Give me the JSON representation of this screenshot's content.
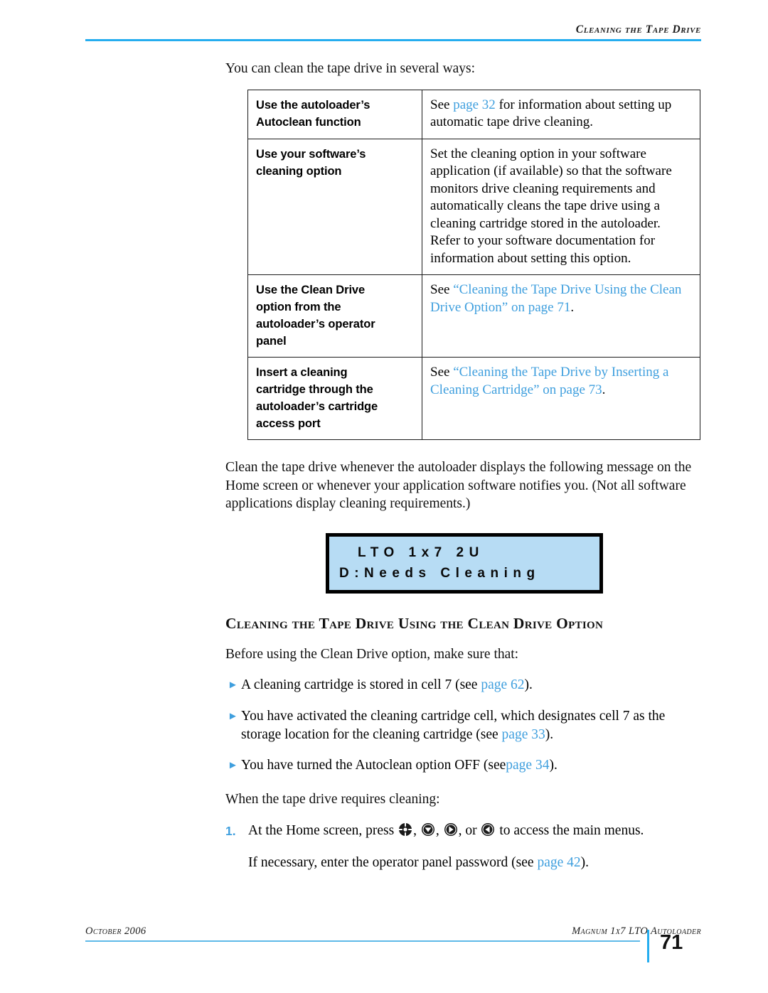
{
  "header": {
    "title": "Cleaning the Tape Drive"
  },
  "intro": {
    "lead": "You can clean the tape drive in several ways:"
  },
  "methods_table": {
    "rows": [
      {
        "label_line1": "Use the autoloader’s",
        "label_line2": "Autoclean function",
        "desc_prefix": "See ",
        "desc_link": "page 32",
        "desc_suffix": " for information about setting up automatic tape drive cleaning."
      },
      {
        "label_line1": "Use your software’s",
        "label_line2": "cleaning option",
        "desc_prefix": "Set the cleaning option in your software application (if available) so that the software monitors drive cleaning requirements and automatically cleans the tape drive using a cleaning cartridge stored in the autoloader. Refer to your software documentation for information about setting this option.",
        "desc_link": "",
        "desc_suffix": ""
      },
      {
        "label_line1": "Use the Clean Drive",
        "label_line2": "option from the",
        "label_line3": "autoloader’s operator",
        "label_line4": "panel",
        "desc_prefix": "See ",
        "desc_link": "“Cleaning the Tape Drive Using the Clean Drive Option” on page 71",
        "desc_suffix": "."
      },
      {
        "label_line1": "Insert a cleaning",
        "label_line2": "cartridge through the",
        "label_line3": "autoloader’s cartridge",
        "label_line4": "access port",
        "desc_prefix": "See ",
        "desc_link": "“Cleaning the Tape Drive by Inserting a Cleaning Cartridge” on page 73",
        "desc_suffix": "."
      }
    ]
  },
  "message_paragraph": "Clean the tape drive whenever the autoloader displays the following message on the Home screen or whenever your application software notifies you. (Not all software applications display cleaning requirements.)",
  "lcd": {
    "line1": "LTO 1x7 2U",
    "line2": "D:Needs Cleaning"
  },
  "section": {
    "heading": "Cleaning the Tape Drive Using the Clean Drive Option",
    "intro": "Before using the Clean Drive option, make sure that:"
  },
  "bullets": [
    {
      "marker": "triangle-right",
      "prefix": "A cleaning cartridge is stored in cell 7 (see ",
      "link": "page 62",
      "suffix": ")."
    },
    {
      "marker": "triangle-right",
      "prefix": "You have activated the cleaning cartridge cell, which designates cell 7 as the storage location for the cleaning cartridge (see ",
      "link": "page 33",
      "suffix": ")."
    },
    {
      "marker": "triangle-right",
      "prefix": "You have turned the Autoclean option OFF (see",
      "link": "page 34",
      "suffix": ")."
    }
  ],
  "procedure": {
    "lead": "When the tape drive requires cleaning:",
    "step_number": "1.",
    "step_prefix": "At the Home screen, press ",
    "step_sep1": ", ",
    "step_sep2": ", ",
    "step_sep3": ", or ",
    "step_suffix": " to access the main menus.",
    "buttons": [
      "select-button",
      "down-arrow-button",
      "right-arrow-button",
      "left-arrow-button"
    ],
    "substep_prefix": "If necessary, enter the operator panel password (see ",
    "substep_link": "page 42",
    "substep_suffix": ")."
  },
  "footer": {
    "left": "October 2006",
    "right": "Magnum 1x7 LTO Autoloader",
    "page_number": "71"
  },
  "colors": {
    "rule_blue": "#25ADEF",
    "link_blue": "#3F9FDE",
    "lcd_background": "#B7DCF4"
  }
}
